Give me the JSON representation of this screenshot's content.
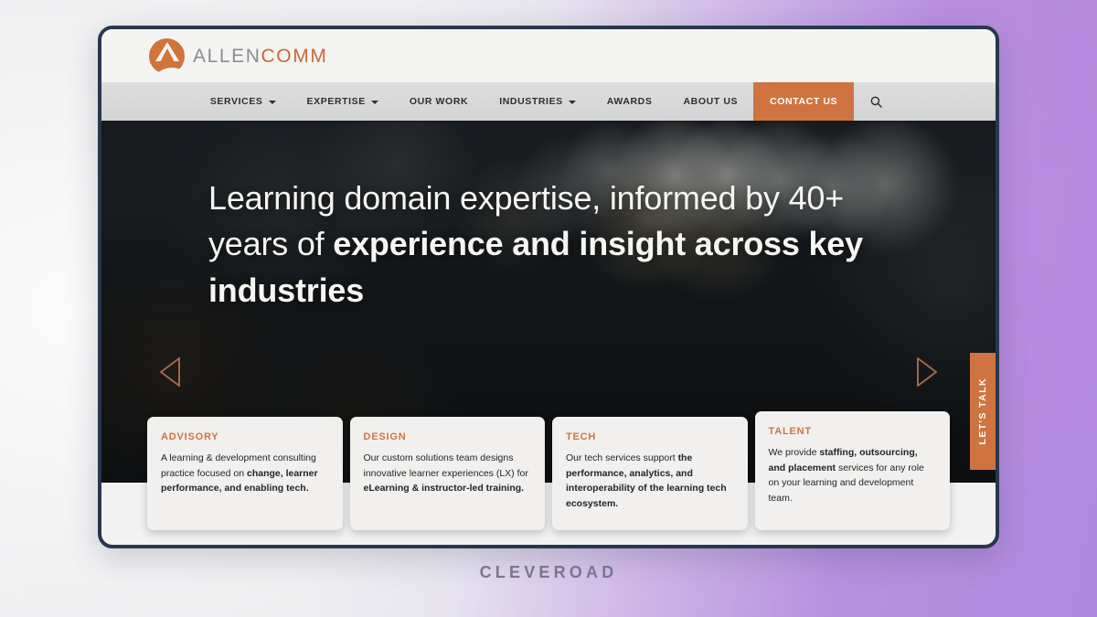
{
  "brand": {
    "logo_text_part1": "ALLEN",
    "logo_text_part2": "COMM",
    "logo_icon": "allencomm-a-mark-icon",
    "accent_color": "#cf7440",
    "frame_border_color": "#27374d"
  },
  "nav": {
    "items": [
      {
        "label": "SERVICES",
        "has_dropdown": true
      },
      {
        "label": "EXPERTISE",
        "has_dropdown": true
      },
      {
        "label": "OUR WORK",
        "has_dropdown": false
      },
      {
        "label": "INDUSTRIES",
        "has_dropdown": true
      },
      {
        "label": "AWARDS",
        "has_dropdown": false
      },
      {
        "label": "ABOUT US",
        "has_dropdown": false
      }
    ],
    "cta": {
      "label": "CONTACT US"
    },
    "search_icon": "search-icon"
  },
  "hero": {
    "headline_plain_1": "Learning domain expertise, informed by ",
    "headline_plain_2": "40+ years of ",
    "headline_bold_1": "experience and insight",
    "headline_bold_2": "across key industries",
    "prev_arrow_icon": "chevron-left-icon",
    "next_arrow_icon": "chevron-right-icon"
  },
  "side_tab": {
    "label": "LET'S TALK"
  },
  "cards": [
    {
      "title": "ADVISORY",
      "text_plain_1": "A learning & development consulting practice focused on ",
      "text_bold": "change, learner performance, and enabling tech.",
      "text_plain_2": ""
    },
    {
      "title": "DESIGN",
      "text_plain_1": "Our custom solutions team designs innovative learner experiences (LX) for ",
      "text_bold": "eLearning & instructor-led training.",
      "text_plain_2": ""
    },
    {
      "title": "TECH",
      "text_plain_1": "Our tech services support ",
      "text_bold": "the performance, analytics, and interoperability of the learning tech ecosystem.",
      "text_plain_2": ""
    },
    {
      "title": "TALENT",
      "text_plain_1": "We provide ",
      "text_bold": "staffing, outsourcing, and placement",
      "text_plain_2": " services for any role on your learning and development team."
    }
  ],
  "watermark": {
    "label": "CLEVEROAD"
  }
}
